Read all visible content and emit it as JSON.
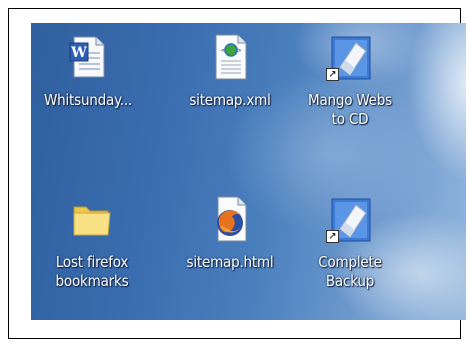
{
  "desktop": {
    "icons": [
      {
        "label": "Whitsunday...",
        "icon": "word-document-icon"
      },
      {
        "label": "sitemap.xml",
        "icon": "xml-file-icon"
      },
      {
        "label": "Mango Webs\nto CD",
        "icon": "eraser-shortcut-icon"
      },
      {
        "label": "Lost firefox\nbookmarks",
        "icon": "folder-icon"
      },
      {
        "label": "sitemap.html",
        "icon": "firefox-html-icon"
      },
      {
        "label": "Complete\nBackup",
        "icon": "eraser-shortcut-icon"
      }
    ],
    "shortcut_arrow": "↗"
  }
}
